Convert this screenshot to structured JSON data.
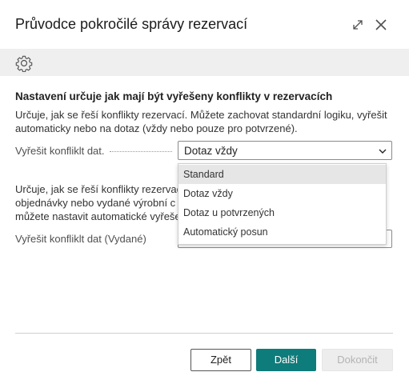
{
  "dialog": {
    "title": "Průvodce pokročilé správy rezervací"
  },
  "section": {
    "title": "Nastavení určuje jak mají být vyřešeny konflikty v rezervacích"
  },
  "field1": {
    "description": "Určuje, jak se řeší konflikty rezervací. Můžete zachovat standardní logiku, vyřešit automaticky nebo na dotaz (vždy nebo pouze pro potvrzené).",
    "label": "Vyřešit konfliklt dat.",
    "value": "Dotaz vždy"
  },
  "field2": {
    "description_lines": [
      "Určuje, jak se řeší konflikty rezervac",
      "objednávky nebo vydané výrobní c",
      "můžete nastavit automatické vyřeše"
    ],
    "label": "Vyřešit konfliklt dat (Vydané)"
  },
  "dropdown": {
    "options": [
      "Standard",
      "Dotaz vždy",
      "Dotaz u potvrzených",
      "Automatický posun"
    ],
    "highlighted": "Standard"
  },
  "footer": {
    "back_label": "Zpět",
    "next_label": "Další",
    "finish_label": "Dokončit"
  },
  "colors": {
    "accent": "#0e7c7b",
    "toolbar_bg": "#efefef",
    "disabled_bg": "#ededed"
  },
  "icons": {
    "expand": "expand-icon",
    "close": "close-icon",
    "settings": "gear-icon",
    "dropdown": "chevron-down-icon"
  }
}
